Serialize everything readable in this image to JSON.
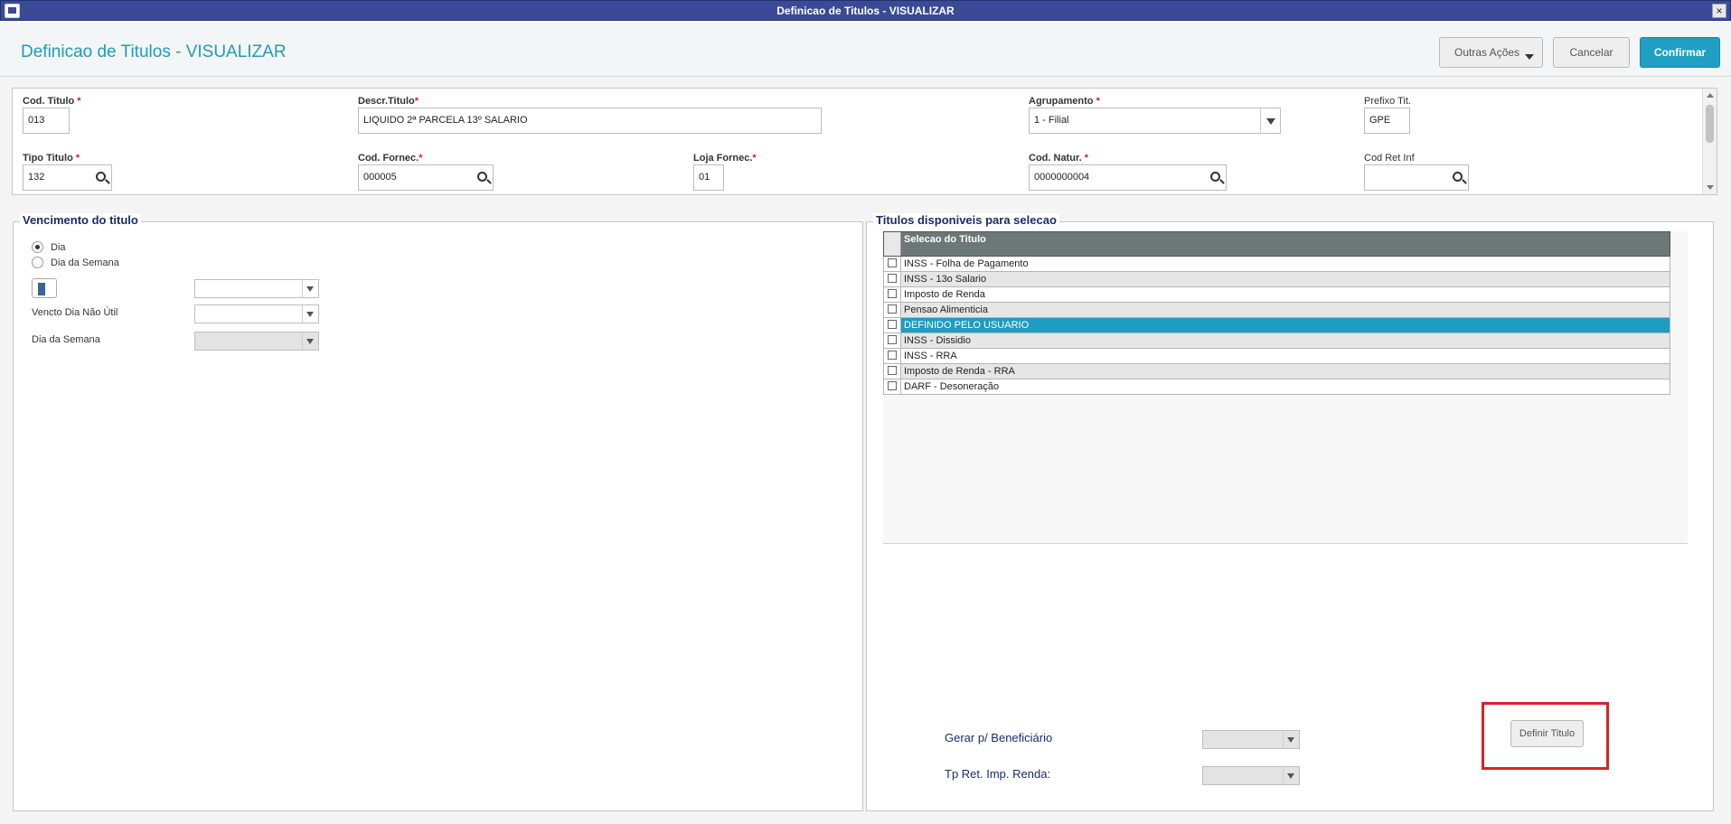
{
  "window": {
    "title": "Definicao de Titulos - VISUALIZAR",
    "close": "×"
  },
  "header": {
    "page_title": "Definicao de Titulos - VISUALIZAR",
    "btn_outras": "Outras Ações",
    "btn_cancelar": "Cancelar",
    "btn_confirmar": "Confirmar"
  },
  "fields": {
    "cod_titulo": {
      "label": "Cod. Titulo",
      "value": "013"
    },
    "descr_titulo": {
      "label": "Descr.Titulo",
      "value": "LIQUIDO 2ª PARCELA 13º SALARIO"
    },
    "agrupamento": {
      "label": "Agrupamento",
      "value": "1 - Filial"
    },
    "prefixo_tit": {
      "label": "Prefixo Tit.",
      "value": "GPE"
    },
    "tipo_titulo": {
      "label": "Tipo Titulo",
      "value": "132"
    },
    "cod_fornec": {
      "label": "Cod. Fornec.",
      "value": "000005"
    },
    "loja_fornec": {
      "label": "Loja Fornec.",
      "value": "01"
    },
    "cod_natur": {
      "label": "Cod. Natur.",
      "value": "0000000004"
    },
    "cod_ret_inf": {
      "label": "Cod Ret Inf",
      "value": ""
    },
    "required_mark": "*"
  },
  "vencimento": {
    "title": "Vencimento do titulo",
    "radio_dia": "Dia",
    "radio_dia_semana": "Dia da Semana",
    "selected": "Dia",
    "lbl_vencto_nao_util": "Vencto Dia Não Útil",
    "lbl_dia_semana": "Dia da Semana"
  },
  "titulos": {
    "title": "Titulos disponiveis para selecao",
    "column": "Selecao do Titulo",
    "rows": [
      {
        "label": "INSS - Folha de Pagamento",
        "checked": false
      },
      {
        "label": "INSS - 13o Salario",
        "checked": false
      },
      {
        "label": "Imposto de Renda",
        "checked": false
      },
      {
        "label": "Pensao Alimenticia",
        "checked": false
      },
      {
        "label": "DEFINIDO PELO USUARIO",
        "checked": true,
        "selected": true
      },
      {
        "label": "INSS - Dissidio",
        "checked": false
      },
      {
        "label": "INSS - RRA",
        "checked": false
      },
      {
        "label": "Imposto de Renda - RRA",
        "checked": false
      },
      {
        "label": "DARF - Desoneração",
        "checked": false
      }
    ],
    "check_mark": "✕",
    "lbl_gerar_benef": "Gerar p/ Beneficiário",
    "lbl_tp_ret": "Tp Ret. Imp. Renda:",
    "btn_definir": "Definir Titulo"
  },
  "colors": {
    "accent": "#1f9cc0",
    "titlebar": "#3a4a96",
    "highlight": "#d9222a",
    "group_title": "#1b2a6b"
  }
}
